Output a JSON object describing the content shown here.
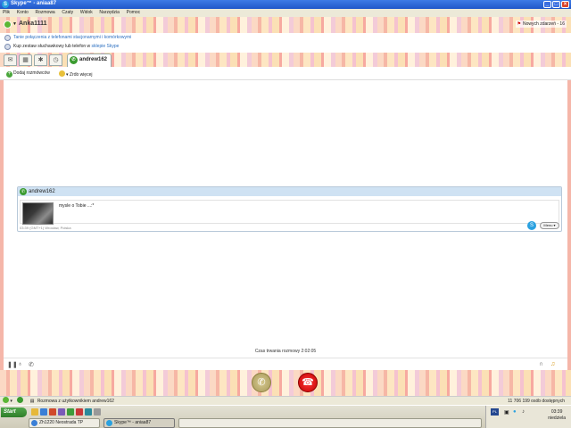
{
  "window": {
    "title": "Skype™ - aniaa87",
    "minimize": "_",
    "maximize": "□",
    "close": "×"
  },
  "menu": [
    "Plik",
    "Konto",
    "Rozmowa",
    "Czaty",
    "Widok",
    "Narzędzia",
    "Pomoc"
  ],
  "profile": {
    "username": "Anka1111",
    "events_label": "Nowych zdarzeń - 16"
  },
  "notices": [
    {
      "text": "Tanie połączenia z telefonami stacjonarnymi i komórkowymi",
      "link": ""
    },
    {
      "text": "Kup zestaw słuchawkowy lub telefon w ",
      "link": "sklepie Skype"
    }
  ],
  "tabs": {
    "call_tab_label": "andrew162"
  },
  "actions": {
    "add_participants": "Dodaj rozmówców",
    "do_more": "Zrób więcej"
  },
  "chat": {
    "contact": "andrew162",
    "message": "mysle o Tobie ...:*",
    "meta": "03:39 (GMT+1) Wrocław, Polska",
    "menu_label": "Menu"
  },
  "call": {
    "duration": "Czas trwania rozmowy 2:02:05"
  },
  "statusbar": {
    "text": "Rozmowa z użytkownikiem andrew162",
    "users_online": "11 706 199 osób dostępnych"
  },
  "taskbar": {
    "start": "Start",
    "tasks": [
      "Zh1220 Neostrada TP",
      "Skype™ - aniaa87"
    ],
    "lang": "PL",
    "time": "03:39",
    "day": "niedziela"
  },
  "colors": {
    "accent": "#2aa1e0",
    "call_green": "#3a9b2f",
    "hangup_red": "#d40000",
    "titlebar_blue": "#2459cf"
  }
}
